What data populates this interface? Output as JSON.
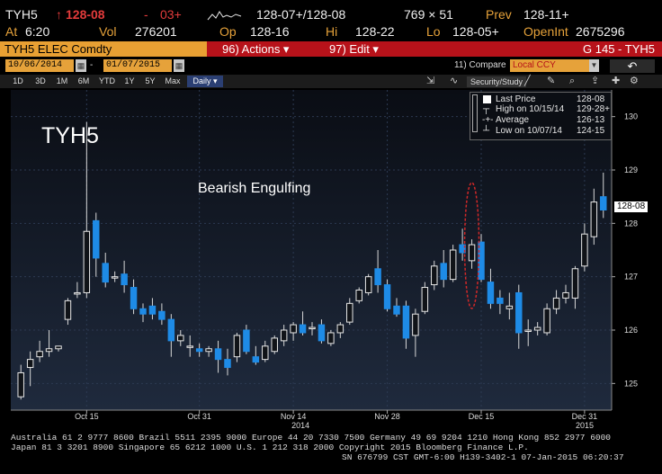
{
  "quote": {
    "ticker": "TYH5",
    "last": "128-08",
    "change": "03+",
    "pair": "128-07+/128-08",
    "size": "769 × 51",
    "prev_label": "Prev",
    "prev": "128-11+",
    "at_label": "At",
    "time": "6:20",
    "vol_label": "Vol",
    "vol": "276201",
    "open_label": "Op",
    "open": "128-16",
    "hi_label": "Hi",
    "hi": "128-22",
    "lo_label": "Lo",
    "lo": "128-05+",
    "oi_label": "OpenInt",
    "oi": "2675296"
  },
  "titlebar": {
    "security": "TYH5 ELEC Comdty",
    "actions": "96) Actions ▾",
    "edit": "97) Edit ▾",
    "gcode": "G 145 - TYH5"
  },
  "daterow": {
    "start": "10/06/2014",
    "end": "01/07/2015",
    "compare": "11) Compare",
    "currency": "Local CCY"
  },
  "periods": [
    "1D",
    "3D",
    "1M",
    "6M",
    "YTD",
    "1Y",
    "5Y",
    "Max",
    "Daily ▾"
  ],
  "toolbar": {
    "study": "Security/Study"
  },
  "chart_data": {
    "type": "candlestick",
    "title": "TYH5",
    "annotation": "Bearish Engulfing",
    "legend": {
      "last_price": "Last Price",
      "last_price_value": "128-08",
      "high": "High on 10/15/14",
      "high_value": "129-28+",
      "average": "Average",
      "average_value": "126-13",
      "low": "Low on 10/07/14",
      "low_value": "124-15"
    },
    "y_ticks": [
      "130",
      "129",
      "128",
      "127",
      "126",
      "125"
    ],
    "ylim": [
      124.5,
      130.5
    ],
    "x_tick_labels": [
      "Oct 15",
      "Oct 31",
      "Nov 14",
      "Nov 28",
      "Dec 15",
      "Dec 31"
    ],
    "x_year_labels": [
      "2014",
      "2015"
    ],
    "last_price_label": "128-08",
    "candles": [
      {
        "o": 124.75,
        "h": 125.35,
        "l": 124.7,
        "c": 125.2
      },
      {
        "o": 125.3,
        "h": 125.6,
        "l": 124.95,
        "c": 125.45
      },
      {
        "o": 125.5,
        "h": 125.8,
        "l": 125.4,
        "c": 125.6
      },
      {
        "o": 125.6,
        "h": 126.0,
        "l": 125.5,
        "c": 125.65
      },
      {
        "o": 125.65,
        "h": 125.7,
        "l": 125.6,
        "c": 125.7
      },
      {
        "o": 126.2,
        "h": 126.6,
        "l": 126.1,
        "c": 126.55
      },
      {
        "o": 126.7,
        "h": 126.9,
        "l": 126.6,
        "c": 126.7
      },
      {
        "o": 126.7,
        "h": 129.9,
        "l": 126.6,
        "c": 127.85
      },
      {
        "o": 128.05,
        "h": 128.2,
        "l": 127.0,
        "c": 127.35
      },
      {
        "o": 127.25,
        "h": 127.45,
        "l": 126.8,
        "c": 126.9
      },
      {
        "o": 127.0,
        "h": 127.1,
        "l": 126.9,
        "c": 127.0
      },
      {
        "o": 127.05,
        "h": 127.3,
        "l": 126.7,
        "c": 126.85
      },
      {
        "o": 126.8,
        "h": 126.95,
        "l": 126.3,
        "c": 126.4
      },
      {
        "o": 126.4,
        "h": 126.5,
        "l": 126.15,
        "c": 126.3
      },
      {
        "o": 126.45,
        "h": 126.6,
        "l": 126.2,
        "c": 126.3
      },
      {
        "o": 126.35,
        "h": 126.5,
        "l": 126.1,
        "c": 126.2
      },
      {
        "o": 126.2,
        "h": 126.3,
        "l": 125.5,
        "c": 125.8
      },
      {
        "o": 125.8,
        "h": 126.0,
        "l": 125.7,
        "c": 125.9
      },
      {
        "o": 125.7,
        "h": 125.9,
        "l": 125.5,
        "c": 125.7
      },
      {
        "o": 125.65,
        "h": 125.75,
        "l": 125.5,
        "c": 125.6
      },
      {
        "o": 125.6,
        "h": 125.7,
        "l": 125.5,
        "c": 125.65
      },
      {
        "o": 125.65,
        "h": 125.8,
        "l": 125.2,
        "c": 125.45
      },
      {
        "o": 125.45,
        "h": 125.65,
        "l": 125.15,
        "c": 125.3
      },
      {
        "o": 125.5,
        "h": 125.95,
        "l": 125.4,
        "c": 125.9
      },
      {
        "o": 126.0,
        "h": 126.1,
        "l": 125.55,
        "c": 125.6
      },
      {
        "o": 125.5,
        "h": 125.7,
        "l": 125.35,
        "c": 125.4
      },
      {
        "o": 125.45,
        "h": 125.8,
        "l": 125.4,
        "c": 125.7
      },
      {
        "o": 125.6,
        "h": 125.9,
        "l": 125.55,
        "c": 125.85
      },
      {
        "o": 125.8,
        "h": 126.1,
        "l": 125.7,
        "c": 126.0
      },
      {
        "o": 125.95,
        "h": 126.15,
        "l": 125.8,
        "c": 126.1
      },
      {
        "o": 126.1,
        "h": 126.35,
        "l": 125.9,
        "c": 125.95
      },
      {
        "o": 126.05,
        "h": 126.15,
        "l": 125.9,
        "c": 126.05
      },
      {
        "o": 126.1,
        "h": 126.2,
        "l": 125.75,
        "c": 125.8
      },
      {
        "o": 125.75,
        "h": 126.0,
        "l": 125.7,
        "c": 125.95
      },
      {
        "o": 125.95,
        "h": 126.15,
        "l": 125.85,
        "c": 126.1
      },
      {
        "o": 126.15,
        "h": 126.6,
        "l": 126.1,
        "c": 126.5
      },
      {
        "o": 126.55,
        "h": 126.8,
        "l": 126.5,
        "c": 126.75
      },
      {
        "o": 126.7,
        "h": 127.05,
        "l": 126.65,
        "c": 127.0
      },
      {
        "o": 127.15,
        "h": 127.5,
        "l": 126.7,
        "c": 126.85
      },
      {
        "o": 126.85,
        "h": 126.95,
        "l": 126.35,
        "c": 126.4
      },
      {
        "o": 126.45,
        "h": 126.6,
        "l": 126.25,
        "c": 126.3
      },
      {
        "o": 126.45,
        "h": 126.55,
        "l": 125.65,
        "c": 125.85
      },
      {
        "o": 125.9,
        "h": 126.4,
        "l": 125.5,
        "c": 126.3
      },
      {
        "o": 126.35,
        "h": 126.9,
        "l": 126.3,
        "c": 126.8
      },
      {
        "o": 126.85,
        "h": 127.3,
        "l": 126.75,
        "c": 127.2
      },
      {
        "o": 127.25,
        "h": 127.5,
        "l": 126.8,
        "c": 126.95
      },
      {
        "o": 126.95,
        "h": 127.6,
        "l": 126.9,
        "c": 127.5
      },
      {
        "o": 127.6,
        "h": 127.9,
        "l": 127.3,
        "c": 127.45
      },
      {
        "o": 127.3,
        "h": 127.7,
        "l": 127.15,
        "c": 127.6
      },
      {
        "o": 127.65,
        "h": 127.8,
        "l": 126.9,
        "c": 126.95
      },
      {
        "o": 126.9,
        "h": 127.15,
        "l": 126.4,
        "c": 126.5
      },
      {
        "o": 126.6,
        "h": 126.75,
        "l": 126.3,
        "c": 126.5
      },
      {
        "o": 126.4,
        "h": 126.7,
        "l": 126.2,
        "c": 126.45
      },
      {
        "o": 126.7,
        "h": 126.85,
        "l": 125.65,
        "c": 125.95
      },
      {
        "o": 126.0,
        "h": 126.2,
        "l": 125.7,
        "c": 126.0
      },
      {
        "o": 126.0,
        "h": 126.15,
        "l": 125.9,
        "c": 126.05
      },
      {
        "o": 125.95,
        "h": 126.5,
        "l": 125.9,
        "c": 126.4
      },
      {
        "o": 126.4,
        "h": 126.75,
        "l": 126.3,
        "c": 126.6
      },
      {
        "o": 126.6,
        "h": 126.85,
        "l": 126.5,
        "c": 126.7
      },
      {
        "o": 126.6,
        "h": 127.2,
        "l": 126.4,
        "c": 127.15
      },
      {
        "o": 127.2,
        "h": 128.0,
        "l": 127.1,
        "c": 127.8
      },
      {
        "o": 127.75,
        "h": 128.65,
        "l": 127.6,
        "c": 128.4
      },
      {
        "o": 128.5,
        "h": 128.95,
        "l": 128.1,
        "c": 128.25
      }
    ]
  },
  "footer": {
    "line1": "Australia 61 2 9777 8600 Brazil 5511 2395 9000 Europe 44 20 7330 7500 Germany 49 69 9204 1210 Hong Kong 852 2977 6000",
    "line2": "Japan 81 3 3201 8900       Singapore 65 6212 1000       U.S. 1 212 318 2000        Copyright 2015 Bloomberg Finance L.P.",
    "line3": "SN 676799 CST  GMT-6:00 H139-3402-1 07-Jan-2015 06:20:37"
  },
  "colors": {
    "amber": "#e6a23a",
    "red": "#b7121a",
    "up": "#e8e8e8",
    "down": "#1e8be6",
    "accent": "#2b3f73"
  }
}
